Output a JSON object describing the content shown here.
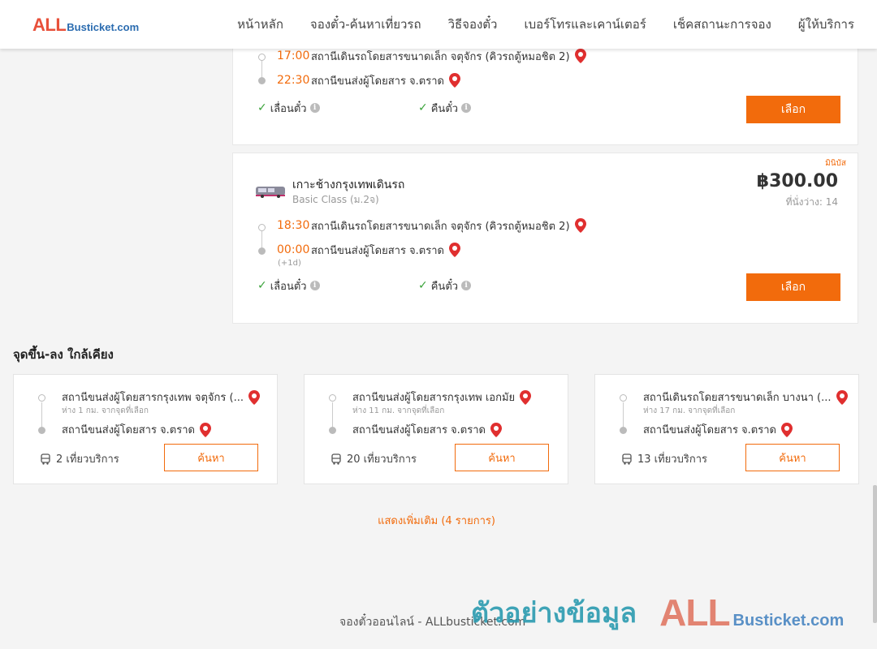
{
  "header": {
    "logo_all": "ALL",
    "logo_rest": "Busticket.com",
    "nav": [
      "หน้าหลัก",
      "จองตั๋ว-ค้นหาเที่ยวรถ",
      "วิธีจองตั๋ว",
      "เบอร์โทรและเคาน์เตอร์",
      "เช็คสถานะการจอง",
      "ผู้ให้บริการ"
    ]
  },
  "trip1": {
    "depart_time": "17:00",
    "depart_station": "สถานีเดินรถโดยสารขนาดเล็ก จตุจักร (คิวรถตู้หมอชิต 2)",
    "arrive_time": "22:30",
    "arrive_station": "สถานีขนส่งผู้โดยสาร จ.ตราด",
    "feature_reschedule": "เลื่อนตั๋ว",
    "feature_refund": "คืนตั๋ว",
    "select_label": "เลือก"
  },
  "trip2": {
    "bus_type": "มินิบัส",
    "operator_name": "เกาะช้างกรุงเทพเดินรถ",
    "bus_class": "Basic Class (ม.2จ)",
    "price": "฿300.00",
    "seats_available": "ที่นั่งว่าง: 14",
    "depart_time": "18:30",
    "depart_station": "สถานีเดินรถโดยสารขนาดเล็ก จตุจักร (คิวรถตู้หมอชิต 2)",
    "arrive_time": "00:00",
    "arrive_day_offset": "(+1d)",
    "arrive_station": "สถานีขนส่งผู้โดยสาร จ.ตราด",
    "feature_reschedule": "เลื่อนตั๋ว",
    "feature_refund": "คืนตั๋ว",
    "select_label": "เลือก"
  },
  "nearby": {
    "title": "จุดขึ้น-ลง ใกล้เคียง",
    "items": [
      {
        "from": "สถานีขนส่งผู้โดยสารกรุงเทพ จตุจักร (...",
        "distance": "ห่าง 1 กม. จากจุดที่เลือก",
        "to": "สถานีขนส่งผู้โดยสาร จ.ตราด",
        "trips": "2 เที่ยวบริการ",
        "search_label": "ค้นหา"
      },
      {
        "from": "สถานีขนส่งผู้โดยสารกรุงเทพ เอกมัย",
        "distance": "ห่าง 11 กม. จากจุดที่เลือก",
        "to": "สถานีขนส่งผู้โดยสาร จ.ตราด",
        "trips": "20 เที่ยวบริการ",
        "search_label": "ค้นหา"
      },
      {
        "from": "สถานีเดินรถโดยสารขนาดเล็ก บางนา (...",
        "distance": "ห่าง 17 กม. จากจุดที่เลือก",
        "to": "สถานีขนส่งผู้โดยสาร จ.ตราด",
        "trips": "13 เที่ยวบริการ",
        "search_label": "ค้นหา"
      }
    ],
    "show_more": "แสดงเพิ่มเติม (4 รายการ)"
  },
  "footer": {
    "text": "จองตั๋วออนไลน์ - ALLbusticket.com"
  },
  "watermark": {
    "thai": "ตัวอย่างข้อมูล",
    "all": "ALL",
    "rest": "Busticket.com"
  },
  "colors": {
    "accent": "#f26b0c",
    "logo_red": "#e8503a",
    "logo_blue": "#2b6cb0",
    "check_green": "#3aa33a",
    "pin_red": "#e02f2f"
  }
}
